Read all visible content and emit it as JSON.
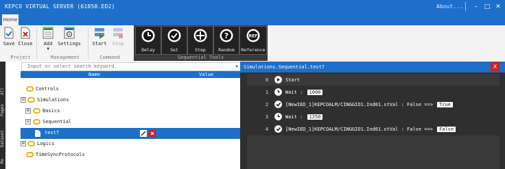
{
  "window": {
    "title": "KEPCO VIRTUAL SERVER (61850.ED2)",
    "about": "About...",
    "minimize": "–",
    "maximize": "□",
    "close": "✕"
  },
  "ribbon": {
    "tab": "Home",
    "groups": [
      {
        "label": "Project"
      },
      {
        "label": "Management"
      },
      {
        "label": "Command"
      },
      {
        "label": "Sequential Tools"
      }
    ],
    "buttons": {
      "save": "Save",
      "close": "Close",
      "add": "Add",
      "settings": "Settings",
      "start": "Start",
      "stop": "Stop",
      "delay": "Delay",
      "set": "Set",
      "step": "Step",
      "random": "Random",
      "reference": "Reference"
    },
    "reference_icon_text": "REF"
  },
  "side_tabs": [
    "All",
    "Pages",
    "Dataset",
    "Re"
  ],
  "left_panel": {
    "search_placeholder": "Input or select search keyword.",
    "columns": {
      "name": "Name",
      "value": "Value"
    },
    "tree": [
      {
        "label": "Controls"
      },
      {
        "label": "Simulations",
        "expander": "⊟"
      },
      {
        "label": "Basics",
        "expander": "⊞"
      },
      {
        "label": "Sequential",
        "expander": "⊟"
      },
      {
        "label": "test7"
      },
      {
        "label": "Logics",
        "expander": "⊞"
      },
      {
        "label": "TimeSyncProtocols"
      }
    ]
  },
  "right_panel": {
    "title": "Simulations.Sequential.test7",
    "close_label": "X",
    "steps": [
      {
        "num": "0",
        "text": "Start"
      },
      {
        "num": "1",
        "text": "Wait :",
        "value": "1000"
      },
      {
        "num": "2",
        "text": "[NewIED_1]KEPCOALM/CINGGIO1.Ind01.stVal : False ==>",
        "value": "True"
      },
      {
        "num": "3",
        "text": "Wait :",
        "value": "1250"
      },
      {
        "num": "4",
        "text": "[NewIED_1]KEPCOALM/CINGGIO1.Ind01.stVal : False ==>",
        "value": "False"
      }
    ]
  },
  "colors": {
    "accent": "#1e6fc8",
    "close_red": "#d21f26",
    "folder": "#f0b21a",
    "dark_panel": "#2f2f2f"
  }
}
